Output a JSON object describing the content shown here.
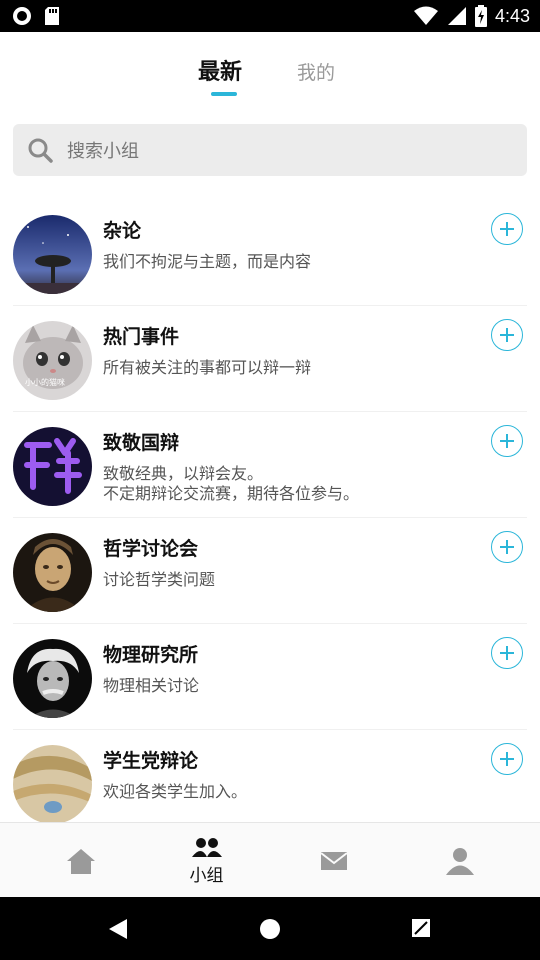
{
  "status_bar": {
    "time": "4:43",
    "icons": [
      "circle-notification-icon",
      "sd-card-icon",
      "wifi-icon",
      "signal-icon",
      "battery-icon"
    ]
  },
  "tabs": [
    {
      "label": "最新",
      "active": true
    },
    {
      "label": "我的",
      "active": false
    }
  ],
  "search": {
    "placeholder": "搜索小组"
  },
  "groups": [
    {
      "name": "杂论",
      "desc": "我们不拘泥与主题，而是内容"
    },
    {
      "name": "热门事件",
      "desc": "所有被关注的事都可以辩一辩"
    },
    {
      "name": "致敬国辩",
      "desc": "致敬经典，以辩会友。\n不定期辩论交流赛，期待各位参与。"
    },
    {
      "name": "哲学讨论会",
      "desc": "讨论哲学类问题"
    },
    {
      "name": "物理研究所",
      "desc": "物理相关讨论"
    },
    {
      "name": "学生党辩论",
      "desc": "欢迎各类学生加入。"
    }
  ],
  "avatar_overlay_text": {
    "hot_events": "小小的猫咪"
  },
  "bottom_nav": [
    {
      "icon": "home-icon",
      "label": ""
    },
    {
      "icon": "group-icon",
      "label": "小组",
      "active": true
    },
    {
      "icon": "mail-icon",
      "label": ""
    },
    {
      "icon": "profile-icon",
      "label": ""
    }
  ],
  "colors": {
    "accent": "#2bb6d9",
    "text_primary": "#111111",
    "text_secondary": "#555555",
    "inactive_tab": "#9a9a9a",
    "search_bg": "#ececec"
  }
}
